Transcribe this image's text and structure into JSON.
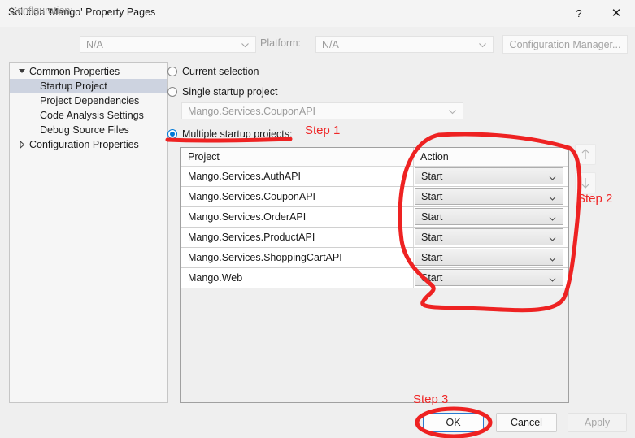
{
  "window": {
    "title": "Solution 'Mango' Property Pages",
    "help_icon": "question-mark-icon",
    "help_glyph": "?",
    "close_icon": "close-icon",
    "close_glyph": "✕"
  },
  "toolbar": {
    "configuration_label": "Configuration:",
    "configuration_value": "N/A",
    "platform_label": "Platform:",
    "platform_value": "N/A",
    "configuration_manager_label": "Configuration Manager..."
  },
  "sidebar": {
    "items": [
      {
        "label": "Common Properties",
        "level": 0,
        "expander": "triangle-down",
        "selected": false
      },
      {
        "label": "Startup Project",
        "level": 1,
        "expander": "none",
        "selected": true
      },
      {
        "label": "Project Dependencies",
        "level": 1,
        "expander": "none",
        "selected": false
      },
      {
        "label": "Code Analysis Settings",
        "level": 1,
        "expander": "none",
        "selected": false
      },
      {
        "label": "Debug Source Files",
        "level": 1,
        "expander": "none",
        "selected": false
      },
      {
        "label": "Configuration Properties",
        "level": 0,
        "expander": "triangle-right",
        "selected": false
      }
    ]
  },
  "main": {
    "options": [
      {
        "label": "Current selection",
        "selected": false
      },
      {
        "label": "Single startup project",
        "selected": false
      },
      {
        "label": "Multiple startup projects:",
        "selected": true
      }
    ],
    "single_startup_value": "Mango.Services.CouponAPI",
    "grid": {
      "columns": [
        "Project",
        "Action"
      ],
      "rows": [
        {
          "project": "Mango.Services.AuthAPI",
          "action": "Start"
        },
        {
          "project": "Mango.Services.CouponAPI",
          "action": "Start"
        },
        {
          "project": "Mango.Services.OrderAPI",
          "action": "Start"
        },
        {
          "project": "Mango.Services.ProductAPI",
          "action": "Start"
        },
        {
          "project": "Mango.Services.ShoppingCartAPI",
          "action": "Start"
        },
        {
          "project": "Mango.Web",
          "action": "Start"
        }
      ]
    },
    "move_up_icon": "arrow-up-icon",
    "move_down_icon": "arrow-down-icon"
  },
  "footer": {
    "ok_label": "OK",
    "cancel_label": "Cancel",
    "apply_label": "Apply"
  },
  "annotations": {
    "step1": "Step 1",
    "step2": "Step 2",
    "step3": "Step 3",
    "ink_color": "#ef2626"
  }
}
